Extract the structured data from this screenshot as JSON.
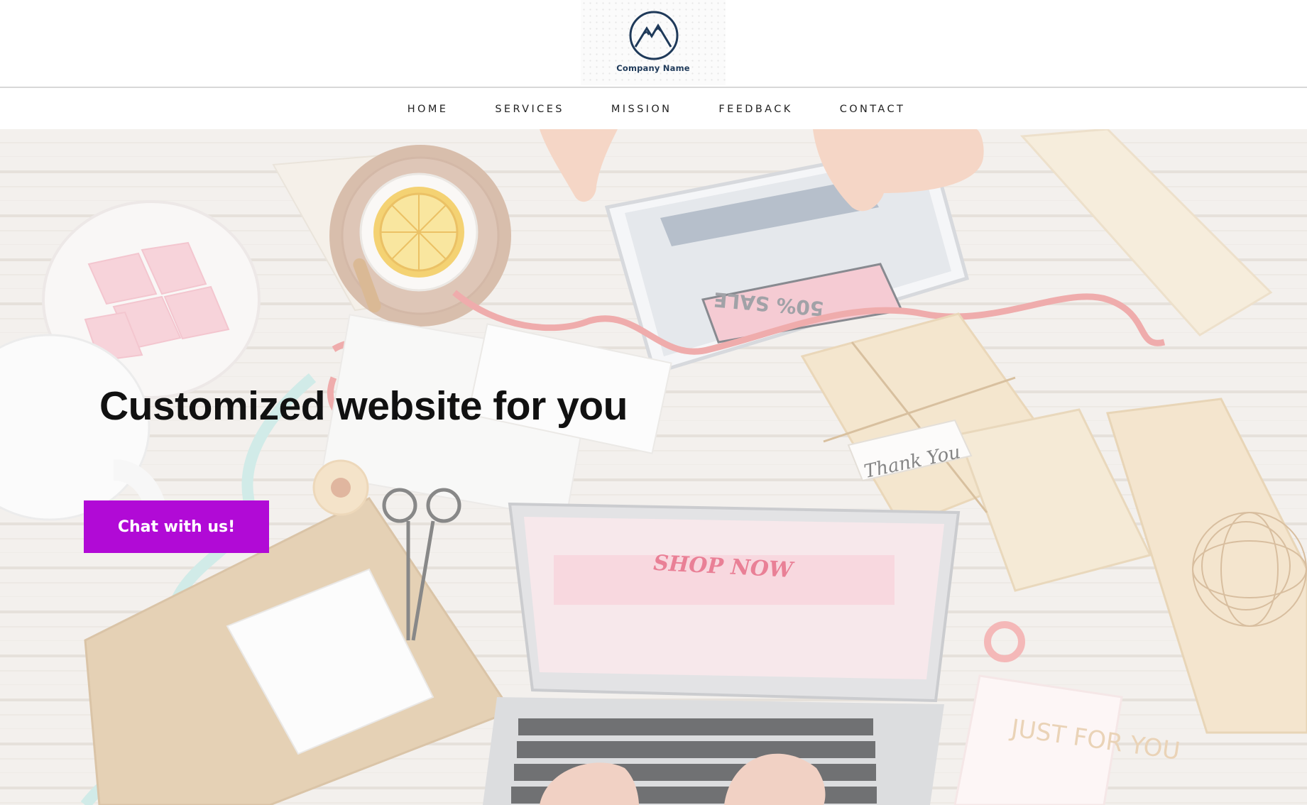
{
  "brand": {
    "company_name": "Company Name",
    "logo_icon": "mountain-icon",
    "logo_color": "#1f3a5a"
  },
  "nav": {
    "items": [
      {
        "label": "HOME"
      },
      {
        "label": "SERVICES"
      },
      {
        "label": "MISSION"
      },
      {
        "label": "FEEDBACK"
      },
      {
        "label": "CONTACT"
      }
    ]
  },
  "hero": {
    "heading": "Customized website for you",
    "cta_label": "Chat with us!",
    "cta_color": "#b10ad6",
    "background_image": "desk-with-laptop-tablet-and-gifts-photo",
    "laptop_screen_text": "SHOP NOW",
    "tablet_screen_text": "50% SALE",
    "gift_tag_text": "Thank You",
    "notebook_text": "JUST FOR YOU"
  }
}
